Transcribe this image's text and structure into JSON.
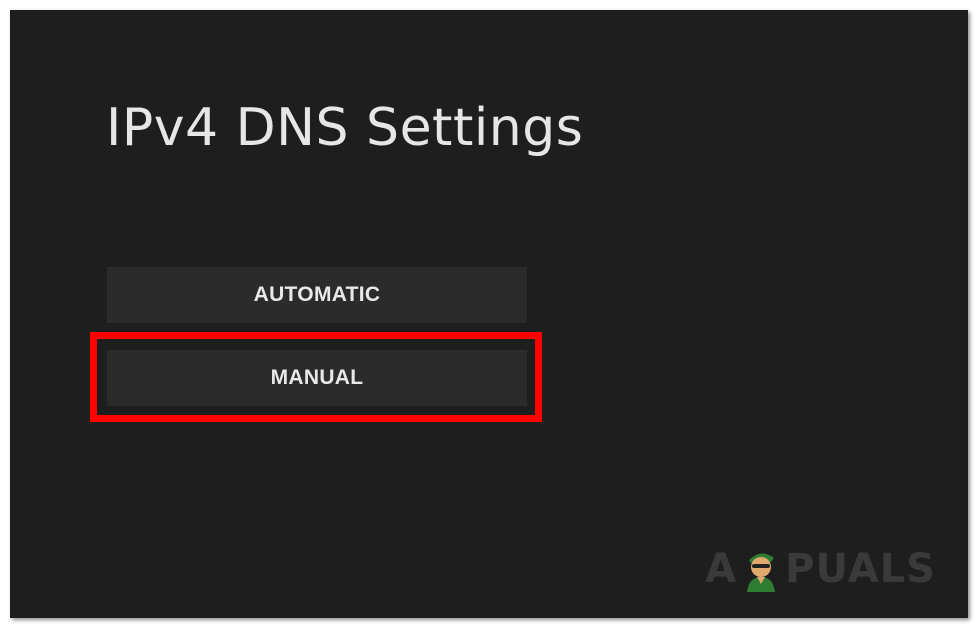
{
  "page": {
    "title": "IPv4 DNS Settings"
  },
  "options": {
    "automatic_label": "AUTOMATIC",
    "manual_label": "MANUAL"
  },
  "highlight": {
    "color": "#ff0000",
    "target": "MANUAL"
  },
  "watermark": {
    "text_before": "A",
    "text_after": "PUALS",
    "icon": "appuals-mascot-icon"
  },
  "colors": {
    "background": "#1e1e1e",
    "button": "#2b2b2b",
    "text": "#e6e6e6"
  }
}
